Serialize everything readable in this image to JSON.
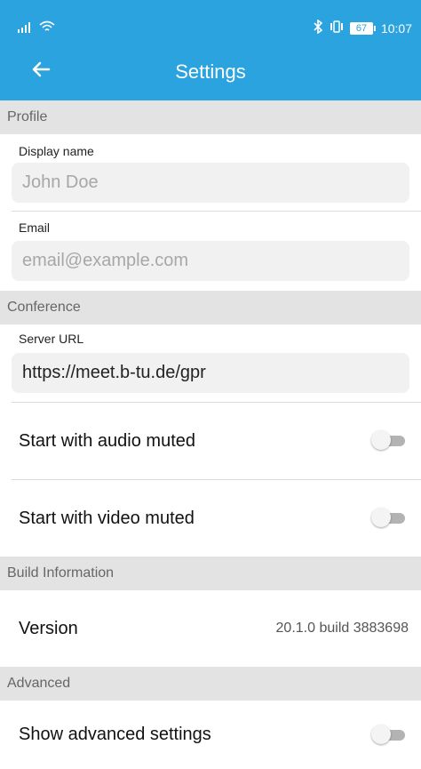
{
  "status_bar": {
    "time": "10:07",
    "battery": "67"
  },
  "app_bar": {
    "title": "Settings"
  },
  "sections": {
    "profile": "Profile",
    "conference": "Conference",
    "build": "Build Information",
    "advanced": "Advanced"
  },
  "profile": {
    "display_name_label": "Display name",
    "display_name_placeholder": "John Doe",
    "email_label": "Email",
    "email_placeholder": "email@example.com"
  },
  "conference": {
    "server_url_label": "Server URL",
    "server_url_value": "https://meet.b-tu.de/gpr",
    "audio_muted_label": "Start with audio muted",
    "audio_muted_on": false,
    "video_muted_label": "Start with video muted",
    "video_muted_on": false
  },
  "build": {
    "version_label": "Version",
    "version_value": "20.1.0 build 3883698"
  },
  "advanced": {
    "show_advanced_label": "Show advanced settings",
    "show_advanced_on": false
  },
  "colors": {
    "primary": "#2aa3df",
    "section_bg": "#e3e3e3"
  },
  "icons": {
    "back": "arrow-back-icon",
    "signal": "signal-icon",
    "wifi": "wifi-icon",
    "bluetooth": "bluetooth-icon",
    "vibrate": "vibrate-icon",
    "battery": "battery-icon"
  }
}
